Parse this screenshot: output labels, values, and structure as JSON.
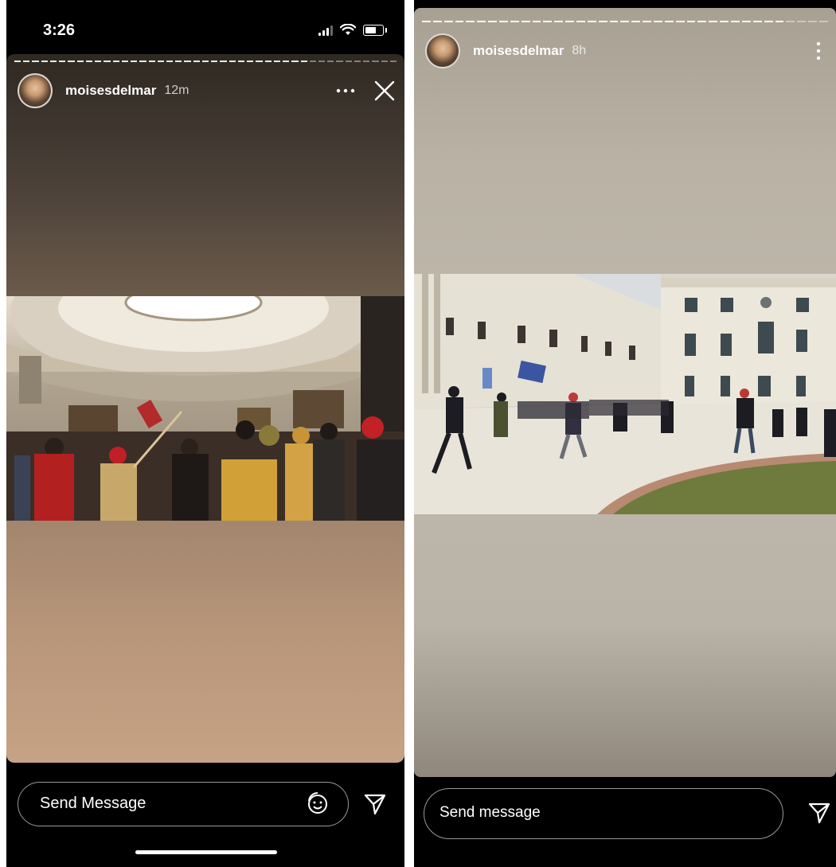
{
  "left_story": {
    "status_time": "3:26",
    "username": "moisesdelmar",
    "time_ago": "12m",
    "more_icon": "ellipsis-horizontal-icon",
    "close_icon": "close-icon",
    "message_placeholder": "Send Message",
    "sticker_icon": "sticker-icon",
    "send_icon": "paper-plane-icon"
  },
  "right_story": {
    "username": "moisesdelmar",
    "time_ago": "8h",
    "more_icon": "ellipsis-vertical-icon",
    "message_placeholder": "Send message",
    "send_icon": "paper-plane-icon"
  }
}
